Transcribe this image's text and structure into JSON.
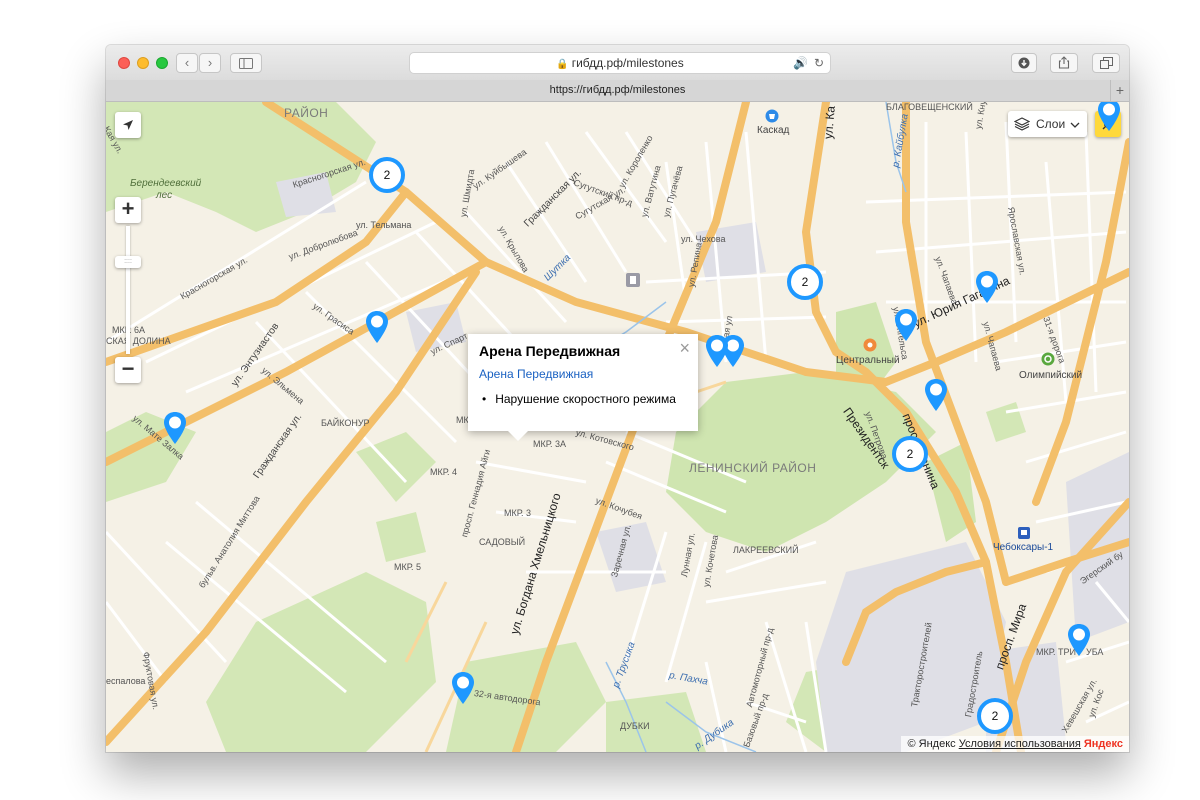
{
  "browser": {
    "url_display": "гибдд.рф/milestones",
    "tab_url": "https://гибдд.рф/milestones",
    "back_icon": "‹",
    "forward_icon": "›",
    "new_tab_icon": "+"
  },
  "map": {
    "layers_label": "Слои",
    "zoom_in": "+",
    "zoom_out": "−",
    "zoom_level_mark": "::::",
    "labels": {
      "raion_top": "РАЙОН",
      "berendeev_1": "Берендеевский",
      "berendeev_2": "лес",
      "kaskad": "Каскад",
      "blagoveshchensky": "БЛАГОВЕЩЕНСКИЙ",
      "tsentralny": "Центральный",
      "olimpiysky": "Олимпийский",
      "leninsky_raion": "ЛЕНИНСКИЙ РАЙОН",
      "baikonur": "БАЙКОНУР",
      "mkr6a": "МКР. 6А",
      "kaya_dolina": "СКАЯ ДОЛИНА",
      "mkr2": "МКР. 2",
      "mkr3a": "МКР. 3А",
      "mkr4": "МКР. 4",
      "mkr3": "МКР. 3",
      "sadovy": "САДОВЫЙ",
      "mkr5": "МКР. 5",
      "lakreevsky": "ЛАКРЕЕВСКИЙ",
      "dubki": "ДУБКИ",
      "chebоksary1": "Чебоксары-1",
      "mkr_tri": "МКР. ТРИ",
      "uba": "УБА",
      "ul_kuibysheva": "ул. Куйбышева",
      "grazhdanskaya_top": "Гражданская ул.",
      "krasnogorskaya": "Красногорская ул.",
      "telmana": "ул. Тельмана",
      "dobrolyubova": "ул. Добролюбова",
      "krasnogorskaya2": "Красногорская ул.",
      "grasisa": "ул. Грасиса",
      "entuziastov": "ул. Энтузиастов",
      "elmena": "ул. Эльмена",
      "grazhdanskaya": "Гражданская ул.",
      "mate_zalka": "ул. Мате Залка",
      "bulv_mittova": "бульв. Анатолия Миттова",
      "fruktovaya": "Фруктовая ул.",
      "espalova": "еспалова",
      "prosp_aigi": "просп. Геннадия Айги",
      "khmelnitskogo": "ул. Богдана Хмельницкого",
      "kotovskogo": "ул. Котовского",
      "kochubeya": "ул. Кочубея",
      "zarechnaya": "Заречная ул.",
      "lunnaya": "Лунная ул.",
      "kochetova": "ул. Кочетова",
      "avtodoroga": "32-я автодорога",
      "trusika": "р. Трусика",
      "pakhta": "р. Пахча",
      "dubika": "р. Дубика",
      "kuzmina": "Сугутская ул.",
      "shmidta": "ул. Шмидта",
      "krylova": "ул. Крылова",
      "surgutsky": "Сугутский пр-д",
      "korolenko": "ул. Короленко",
      "vatutina": "ул. Ватутина",
      "pugacheva": "ул. Пугачёва",
      "chekhova": "ул. Чехова",
      "repina": "ул. Репина",
      "kaban": "р. Кайбулка",
      "ul_ka": "ул. Ка",
      "knuta": "ул. Кнута",
      "engelsa": "ул. Энгельса",
      "chapaeva": "ул. Чапаева",
      "yaroslavskaya": "Ярославская ул.",
      "gagarina": "ул. Юрия Гагарина",
      "dorogi31": "31-я дорога",
      "chapaeva2": "ул. Чапаева",
      "prosp_lenina": "просп. Ленина",
      "presidentsky": "Президентск",
      "petrova": "ул. Петрова",
      "prosp_mira": "просп. Мира",
      "egersky": "Эгерский бу",
      "khevesh": "Хевешская ул.",
      "bazovy": "Базовый пр-д",
      "avtomotornaya": "Автомоторный пр-д",
      "traktor": "Тракторостроителей",
      "gradostr": "Градостроитель",
      "kaya_ul": "Кая ул.",
      "sparta": "ул. Спарт",
      "shutka": "Шутка",
      "evaya": "евая ул",
      "enatskaya": "ул. Кос"
    },
    "clusters": [
      {
        "count": "2"
      },
      {
        "count": "2"
      },
      {
        "count": "2"
      },
      {
        "count": "2"
      }
    ],
    "popup": {
      "title": "Арена Передвижная",
      "link": "Арена Передвижная",
      "item": "Нарушение скоростного режима",
      "close": "×"
    },
    "copyright": {
      "yandex_c": "© Яндекс",
      "terms": "Условия использования",
      "logo": "Яндекс"
    }
  },
  "colors": {
    "cluster_ring": "#1e98ff",
    "pin": "#1e98ff",
    "road_major": "#f5c26b",
    "road_minor": "#ffffff",
    "park": "#cfe5b0",
    "industrial": "#dcdde3",
    "popup_link": "#1a61c2"
  }
}
